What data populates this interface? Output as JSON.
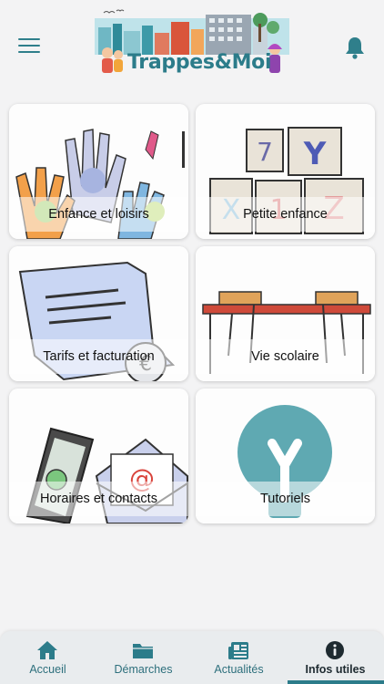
{
  "header": {
    "logo_text": "Trappes&Moi",
    "menu_icon": "hamburger-menu-icon",
    "notification_icon": "bell-icon"
  },
  "tiles": [
    {
      "label": "Enfance et loisirs",
      "image": "painted-hands-illustration"
    },
    {
      "label": "Petite enfance",
      "image": "alphabet-blocks-illustration"
    },
    {
      "label": "Tarifs et facturation",
      "image": "invoice-paper-illustration"
    },
    {
      "label": "Vie scolaire",
      "image": "school-desk-chairs-illustration"
    },
    {
      "label": "Horaires et contacts",
      "image": "phone-and-envelope-illustration"
    },
    {
      "label": "Tutoriels",
      "image": "lightbulb-illustration"
    }
  ],
  "tabbar": {
    "tabs": [
      {
        "label": "Accueil",
        "icon": "home-icon"
      },
      {
        "label": "Démarches",
        "icon": "folder-icon"
      },
      {
        "label": "Actualités",
        "icon": "newspaper-icon"
      },
      {
        "label": "Infos utiles",
        "icon": "info-icon",
        "active": true
      }
    ]
  },
  "colors": {
    "accent": "#2c7c8a",
    "background": "#f3f3f4",
    "tabbar": "#e9ecee"
  }
}
